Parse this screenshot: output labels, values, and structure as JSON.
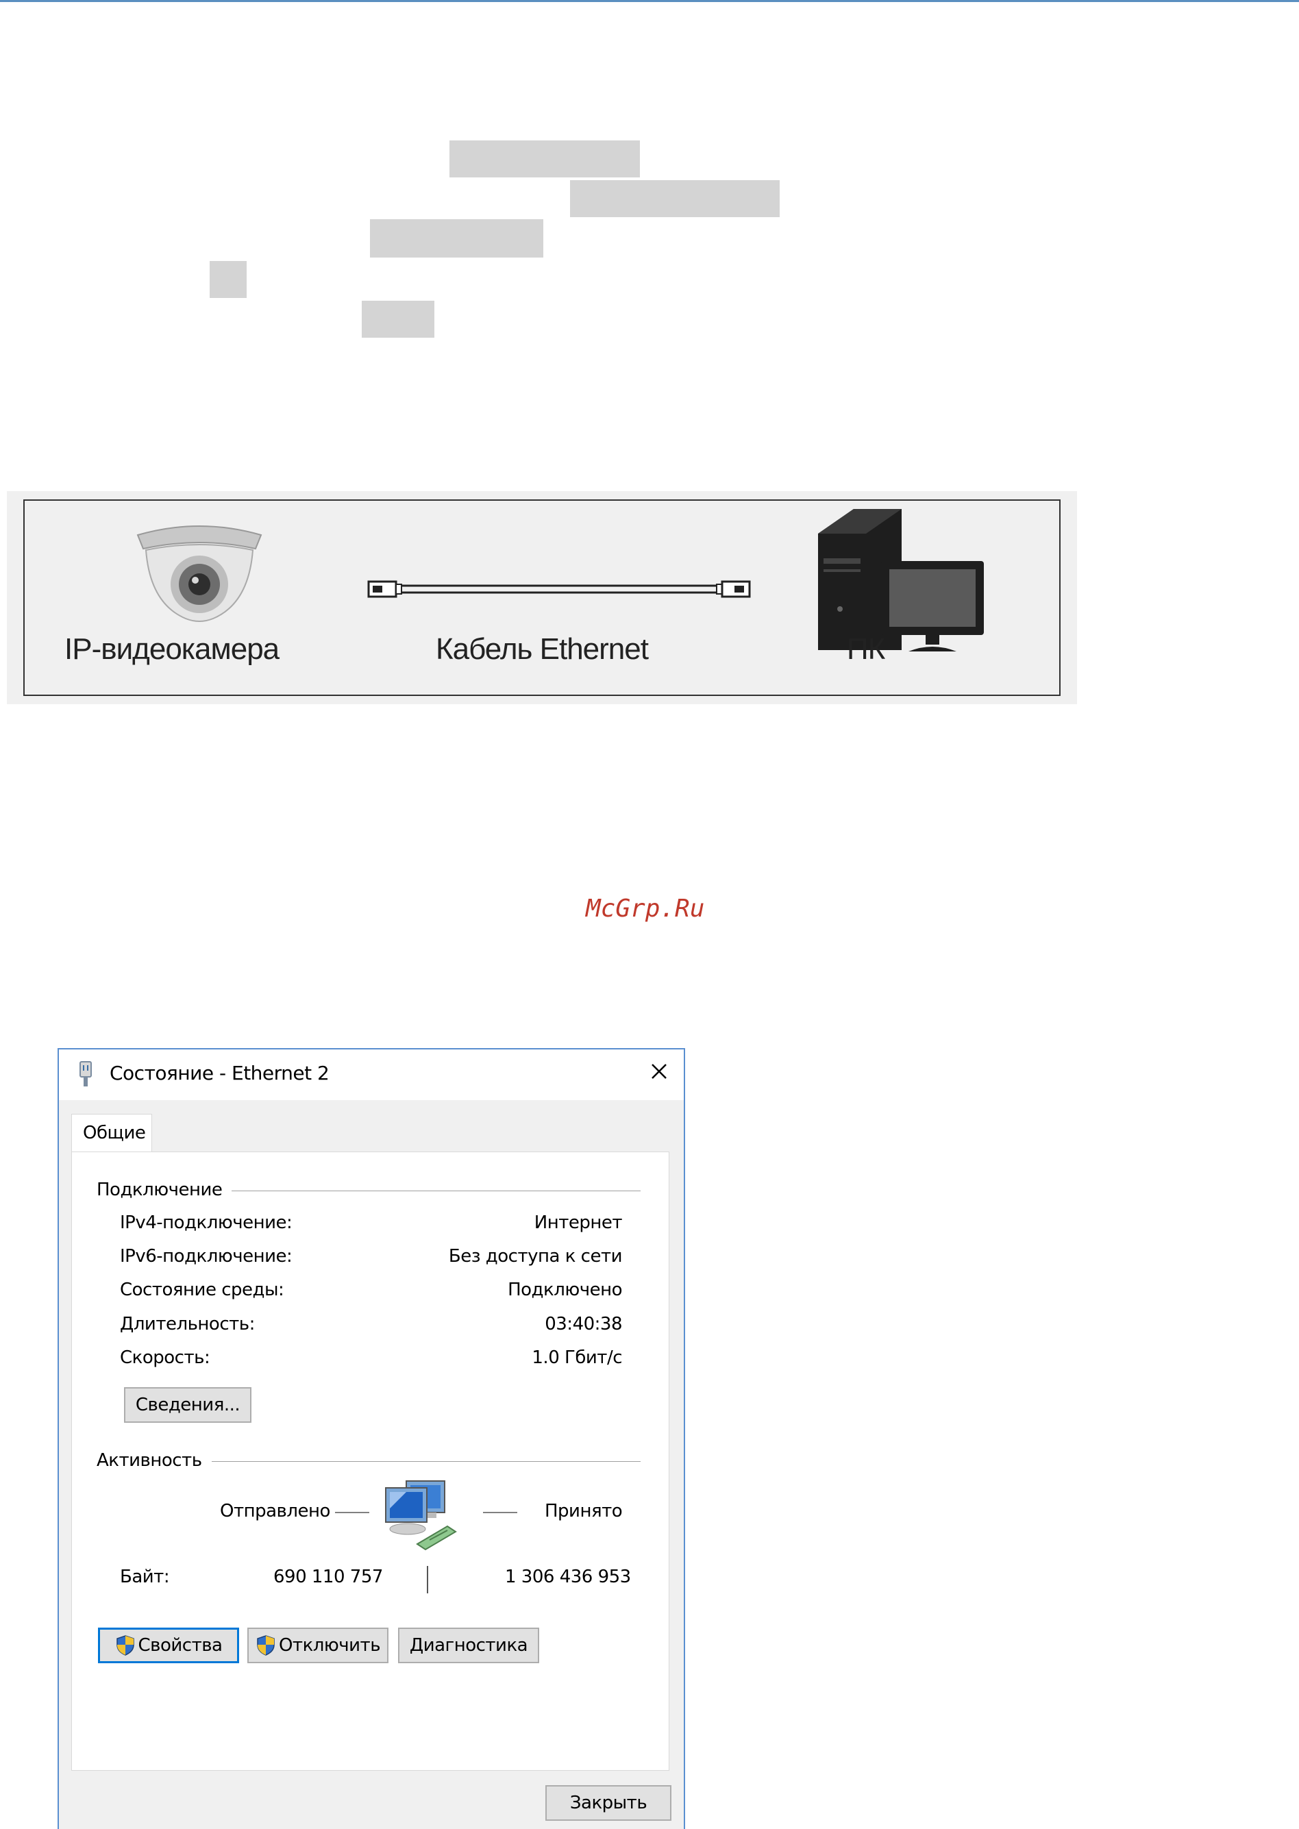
{
  "diagram": {
    "camera_label": "IP-видеокамера",
    "cable_label": "Кабель Ethernet",
    "pc_label": "ПК"
  },
  "watermark": "McGrp.Ru",
  "dialog": {
    "title": "Состояние - Ethernet 2",
    "tab_general": "Общие",
    "connection": {
      "section_title": "Подключение",
      "rows": [
        {
          "label": "IPv4-подключение:",
          "value": "Интернет"
        },
        {
          "label": "IPv6-подключение:",
          "value": "Без доступа к сети"
        },
        {
          "label": "Состояние среды:",
          "value": "Подключено"
        },
        {
          "label": "Длительность:",
          "value": "03:40:38"
        },
        {
          "label": "Скорость:",
          "value": "1.0 Гбит/с"
        }
      ],
      "details_button": "Сведения..."
    },
    "activity": {
      "section_title": "Активность",
      "sent_label": "Отправлено",
      "received_label": "Принято",
      "bytes_label": "Байт:",
      "bytes_sent": "690 110 757",
      "bytes_received": "1 306 436 953"
    },
    "buttons": {
      "properties": "Свойства",
      "disable": "Отключить",
      "diagnose": "Диагностика",
      "close": "Закрыть"
    }
  },
  "colors": {
    "accent": "#0078d7",
    "dialog_border": "#5a8fd0",
    "watermark": "#c0392b",
    "redaction": "#d4d4d4"
  }
}
